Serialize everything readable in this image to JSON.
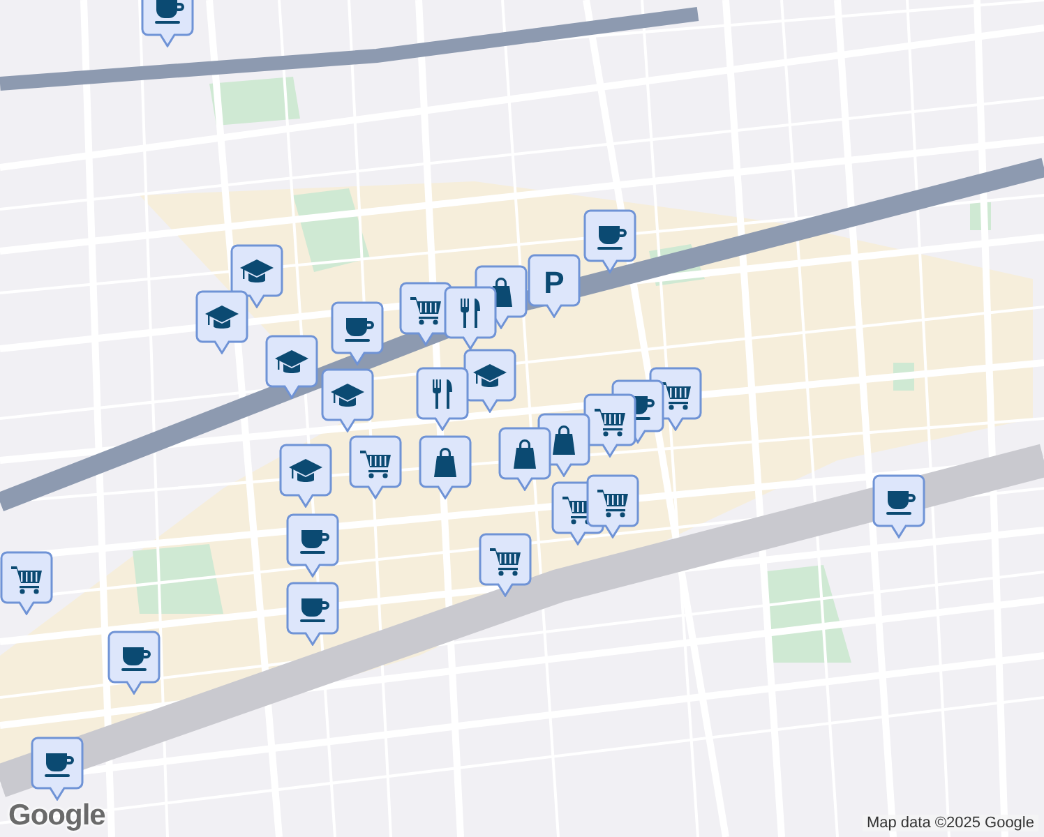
{
  "map": {
    "markers": [
      {
        "kind": "cup"
      },
      {
        "kind": "cup"
      },
      {
        "kind": "parking",
        "label": "P"
      },
      {
        "kind": "cap"
      },
      {
        "kind": "bag"
      },
      {
        "kind": "cart"
      },
      {
        "kind": "fork"
      },
      {
        "kind": "cap"
      },
      {
        "kind": "cup"
      },
      {
        "kind": "cap"
      },
      {
        "kind": "cap"
      },
      {
        "kind": "cap"
      },
      {
        "kind": "cart"
      },
      {
        "kind": "cup"
      },
      {
        "kind": "cart"
      },
      {
        "kind": "fork"
      },
      {
        "kind": "cart"
      },
      {
        "kind": "bag"
      },
      {
        "kind": "bag"
      },
      {
        "kind": "bag"
      },
      {
        "kind": "cap"
      },
      {
        "kind": "cart"
      },
      {
        "kind": "cart"
      },
      {
        "kind": "cart"
      },
      {
        "kind": "cup"
      },
      {
        "kind": "cup"
      },
      {
        "kind": "cart"
      },
      {
        "kind": "cup"
      },
      {
        "kind": "cup"
      },
      {
        "kind": "cup"
      }
    ]
  },
  "logo": "Google",
  "attribution": "Map data ©2025 Google"
}
